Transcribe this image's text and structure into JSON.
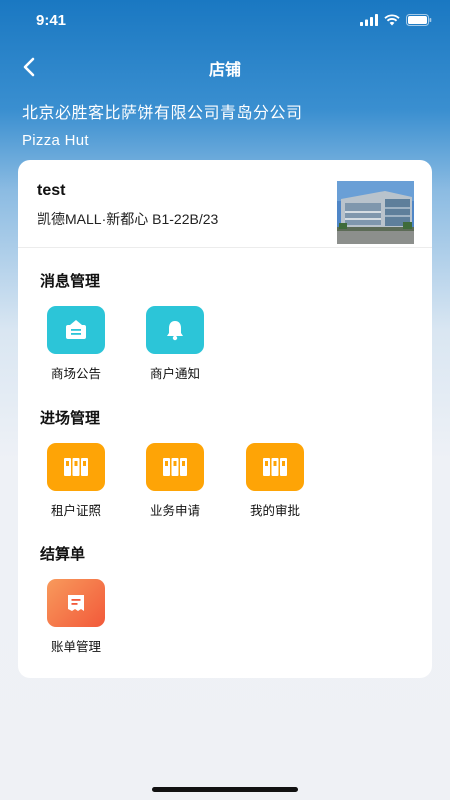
{
  "status": {
    "time": "9:41"
  },
  "nav": {
    "title": "店铺",
    "back_icon": "chevron-left-icon"
  },
  "header": {
    "company": "北京必胜客比萨饼有限公司青岛分公司",
    "brand": "Pizza Hut"
  },
  "store": {
    "name": "test",
    "address": "凯德MALL·新都心 B1-22B/23"
  },
  "sections": [
    {
      "title": "消息管理",
      "items": [
        {
          "label": "商场公告",
          "icon": "announcement-icon",
          "color": "#2cc5d8"
        },
        {
          "label": "商户通知",
          "icon": "bell-icon",
          "color": "#2cc5d8"
        }
      ]
    },
    {
      "title": "进场管理",
      "items": [
        {
          "label": "租户证照",
          "icon": "binders-icon",
          "color": "#fea406"
        },
        {
          "label": "业务申请",
          "icon": "binders-icon",
          "color": "#fea406"
        },
        {
          "label": "我的审批",
          "icon": "binders-icon",
          "color": "#fea406"
        }
      ]
    },
    {
      "title": "结算单",
      "items": [
        {
          "label": "账单管理",
          "icon": "receipt-icon",
          "color": "#f2593a"
        }
      ]
    }
  ]
}
